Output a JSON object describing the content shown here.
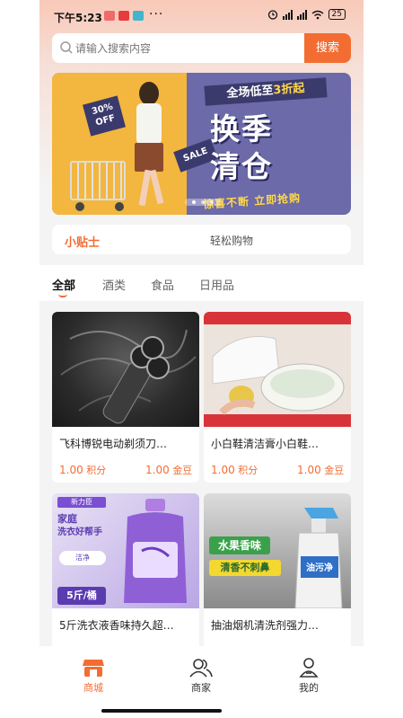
{
  "status_bar": {
    "time": "下午5:23",
    "dots": "···",
    "battery": "25"
  },
  "search": {
    "placeholder": "请输入搜索内容",
    "button": "搜索"
  },
  "banner": {
    "tag_discount_line1": "30%",
    "tag_discount_line2": "OFF",
    "sale_tag": "SALE",
    "ribbon_prefix": "全场低至",
    "ribbon_highlight": "3折起",
    "headline_line1": "换季",
    "headline_line2": "清仓",
    "slogan": "惊喜不断 立即抢购"
  },
  "tips": {
    "label": "小贴士",
    "message": "轻松购物"
  },
  "category_tabs": [
    {
      "label": "全部",
      "active": true
    },
    {
      "label": "酒类",
      "active": false
    },
    {
      "label": "食品",
      "active": false
    },
    {
      "label": "日用品",
      "active": false
    }
  ],
  "products": [
    {
      "title": "飞科博锐电动剃须刀…",
      "points": "1.00",
      "points_unit": "积分",
      "beans": "1.00",
      "beans_unit": "金豆"
    },
    {
      "title": "小白鞋清洁膏小白鞋…",
      "points": "1.00",
      "points_unit": "积分",
      "beans": "1.00",
      "beans_unit": "金豆"
    },
    {
      "title": "5斤洗衣液香味持久超…",
      "img_text_1": "家庭",
      "img_text_2": "洗衣好帮手",
      "img_text_3": "5斤/桶",
      "img_text_4": "新力臣",
      "img_text_5": "洁净"
    },
    {
      "title": "抽油烟机清洗剂强力…",
      "img_text_1": "水果香味",
      "img_text_2": "清香不刺鼻",
      "img_text_3": "油污净"
    }
  ],
  "bottom_nav": [
    {
      "label": "商城",
      "icon": "shop-icon",
      "active": true
    },
    {
      "label": "商家",
      "icon": "merchants-icon",
      "active": false
    },
    {
      "label": "我的",
      "icon": "profile-icon",
      "active": false
    }
  ],
  "colors": {
    "accent": "#f36d33",
    "banner_purple": "#6c6aa8",
    "banner_yellow": "#f3b63e"
  }
}
